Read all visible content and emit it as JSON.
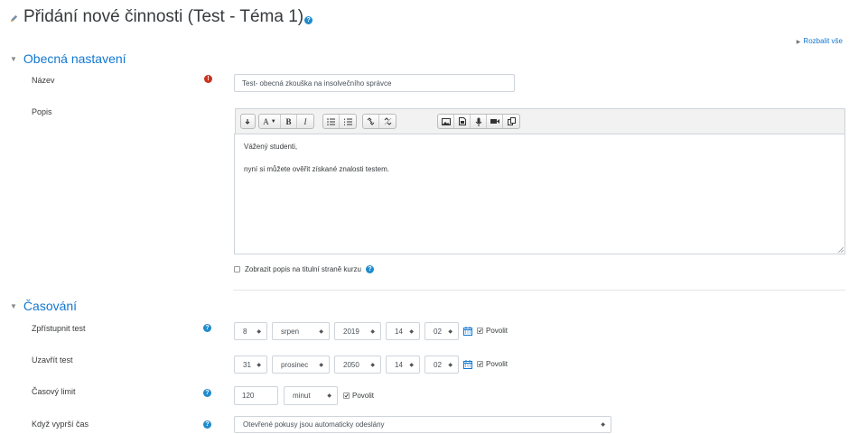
{
  "page": {
    "title": "Přidání nové činnosti (Test - Téma 1)",
    "expand_all": "Rozbalit vše"
  },
  "general": {
    "heading": "Obecná nastavení",
    "name_label": "Název",
    "name_value": "Test- obecná zkouška na insolvečního správce",
    "desc_label": "Popis",
    "editor_lines": [
      "Vážený studenti,",
      "nyní si můžete ověřit získané znalosti testem."
    ],
    "show_desc_label": "Zobrazit popis na titulní straně kurzu"
  },
  "toolbar": {
    "groups": [
      [
        "collapse-icon"
      ],
      [
        "font-style-icon",
        "bold-icon",
        "italic-icon"
      ],
      [
        "unordered-list-icon",
        "ordered-list-icon"
      ],
      [
        "link-icon",
        "unlink-icon"
      ],
      [
        "image-icon",
        "media-icon",
        "record-audio-icon",
        "record-video-icon",
        "manage-files-icon"
      ]
    ],
    "font_style_glyph": "A",
    "bold_glyph": "B",
    "italic_glyph": "I"
  },
  "timing": {
    "heading": "Časování",
    "open": {
      "label": "Zpřístupnit test",
      "day": "8",
      "month": "srpen",
      "year": "2019",
      "hour": "14",
      "minute": "02",
      "enable_label": "Povolit"
    },
    "close": {
      "label": "Uzavřít test",
      "day": "31",
      "month": "prosinec",
      "year": "2050",
      "hour": "14",
      "minute": "02",
      "enable_label": "Povolit"
    },
    "time_limit": {
      "label": "Časový limit",
      "value": "120",
      "unit": "minut",
      "enable_label": "Povolit"
    },
    "when_expires": {
      "label": "Když vyprší čas",
      "value": "Otevřené pokusy jsou automaticky odeslány"
    }
  },
  "colors": {
    "link": "#1177d1",
    "help": "#1f8bcc",
    "required": "#c9321f"
  }
}
